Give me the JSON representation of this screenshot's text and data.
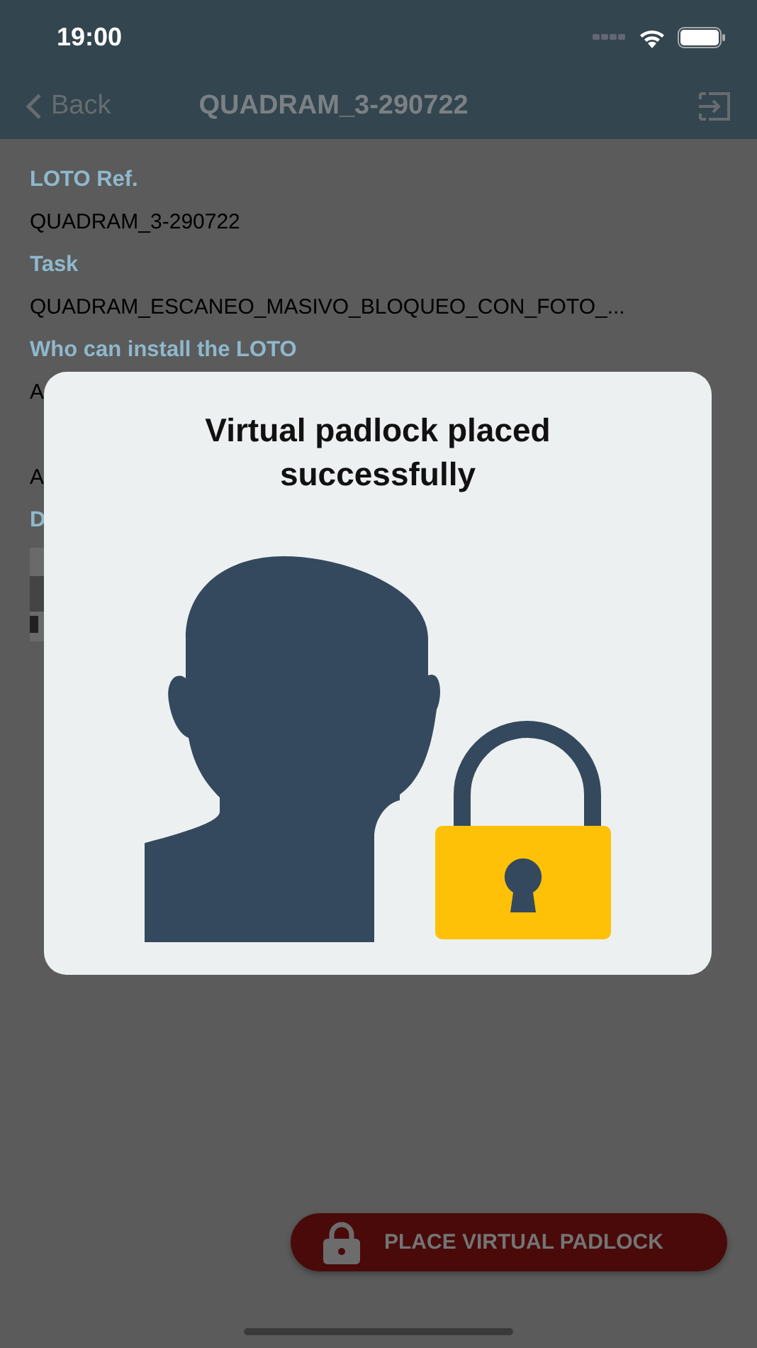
{
  "status_bar": {
    "time": "19:00"
  },
  "nav": {
    "back": "Back",
    "title": "QUADRAM_3-290722"
  },
  "fields": [
    {
      "label": "LOTO Ref.",
      "value": "QUADRAM_3-290722"
    },
    {
      "label": "Task",
      "value": "QUADRAM_ESCANEO_MASIVO_BLOQUEO_CON_FOTO_..."
    },
    {
      "label": "Who can install the LOTO",
      "value": "A"
    },
    {
      "value": "A"
    },
    {
      "label": "D"
    }
  ],
  "dialog": {
    "title": "Virtual padlock placed successfully"
  },
  "action_button": {
    "label": "PLACE VIRTUAL PADLOCK"
  }
}
